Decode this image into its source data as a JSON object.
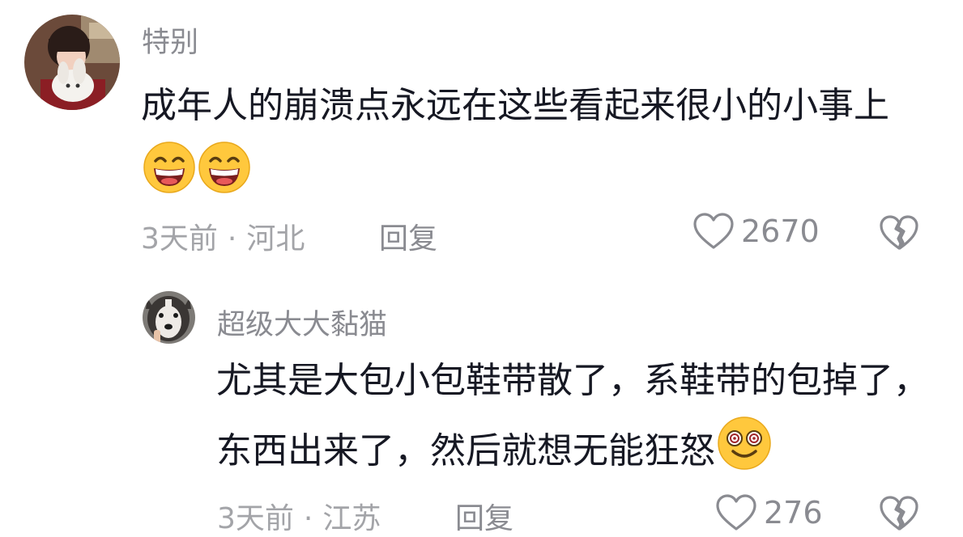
{
  "comments": [
    {
      "username": "特别",
      "text": "成年人的崩溃点永远在这些看起来很小的小事上",
      "emojis": [
        "grin-emoji",
        "grin-emoji"
      ],
      "time": "3天前",
      "location": "河北",
      "separator": "·",
      "reply_label": "回复",
      "like_count": "2670"
    },
    {
      "username": "超级大大黏猫",
      "text": "尤其是大包小包鞋带散了，系鞋带的包掉了，东西出来了，然后就想无能狂怒",
      "emojis": [
        "dizzy-smile-emoji"
      ],
      "time": "3天前",
      "location": "江苏",
      "separator": "·",
      "reply_label": "回复",
      "like_count": "276"
    }
  ],
  "colors": {
    "text_primary": "#161823",
    "text_secondary": "#8a8b91",
    "text_meta": "#a3a4a8",
    "icon_gray": "#8a8b91",
    "emoji_yellow": "#ffc83d"
  },
  "icons": {
    "like": "heart-outline-icon",
    "dislike": "broken-heart-icon"
  }
}
